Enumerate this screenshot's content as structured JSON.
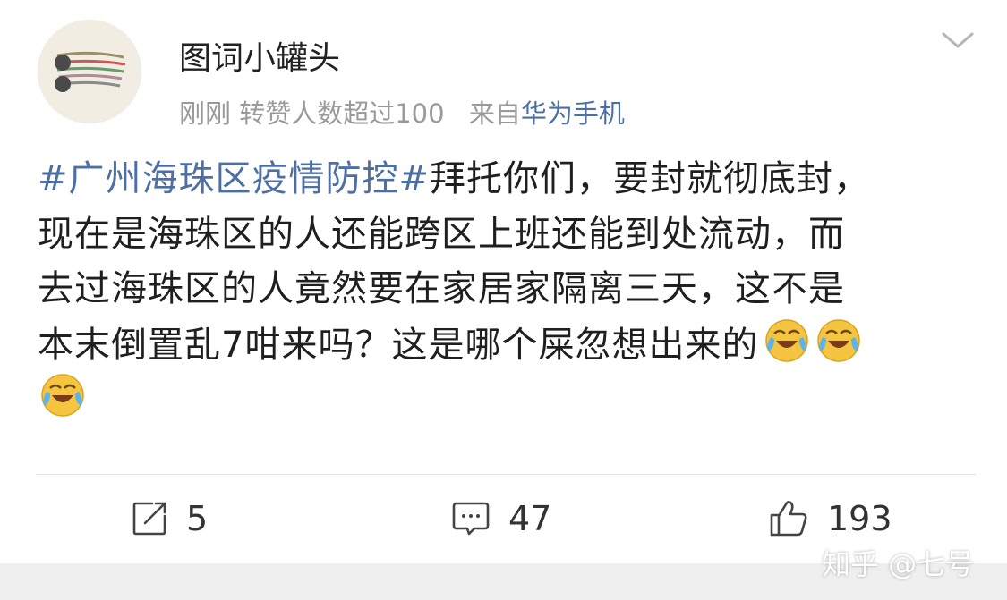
{
  "user": {
    "name": "图词小罐头",
    "avatar_icon": "drawing-avatar-icon"
  },
  "meta": {
    "time": "刚刚",
    "reposts_text": "转赞人数超过100",
    "source_prefix": "来自",
    "device": "华为手机"
  },
  "menu_icon": "chevron-down-icon",
  "content": {
    "hashtag": "#广州海珠区疫情防控#",
    "line1_rest": "拜托你们，要封就彻底封，",
    "line2": "现在是海珠区的人还能跨区上班还能到处流动，而",
    "line3": "去过海珠区的人竟然要在家居家隔离三天，这不是",
    "line4": "本末倒置乱7咁来吗？这是哪个屎忽想出来的",
    "emoji_icon": "laugh-cry-emoji-icon"
  },
  "actions": {
    "repost": {
      "icon": "repost-icon",
      "count": "5"
    },
    "comment": {
      "icon": "comment-icon",
      "count": "47"
    },
    "like": {
      "icon": "thumbs-up-icon",
      "count": "193"
    }
  },
  "watermark": "知乎 @七号",
  "colors": {
    "link": "#4d6fa3",
    "meta": "#9a9a9a",
    "text": "#1f1f1f"
  }
}
